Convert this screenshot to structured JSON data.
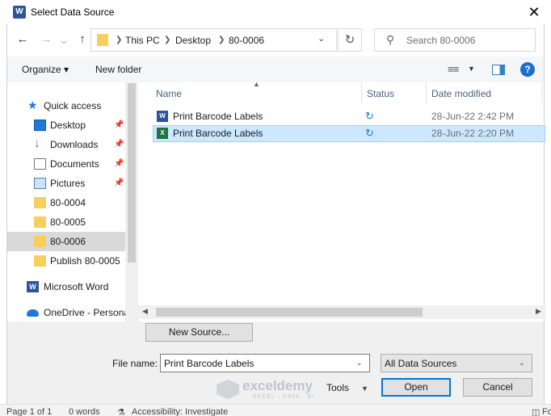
{
  "window": {
    "app_icon": "W",
    "title": "Select Data Source",
    "close": "✕"
  },
  "address": {
    "breadcrumbs": [
      "This PC",
      "Desktop",
      "80-0006"
    ],
    "search_placeholder": "Search 80-0006"
  },
  "toolbar": {
    "organize": "Organize ▾",
    "new_folder": "New folder",
    "help": "?"
  },
  "nav": {
    "items": [
      {
        "label": "Quick access",
        "icon": "star-icon"
      },
      {
        "label": "Desktop",
        "icon": "desktop-icon"
      },
      {
        "label": "Downloads",
        "icon": "download-icon"
      },
      {
        "label": "Documents",
        "icon": "documents-icon"
      },
      {
        "label": "Pictures",
        "icon": "pictures-icon"
      },
      {
        "label": "80-0004",
        "icon": "folder-icon"
      },
      {
        "label": "80-0005",
        "icon": "folder-icon"
      },
      {
        "label": "80-0006",
        "icon": "folder-icon"
      },
      {
        "label": "Publish 80-0005",
        "icon": "folder-icon"
      },
      {
        "label": "Microsoft Word",
        "icon": "word-icon"
      },
      {
        "label": "OneDrive - Persona",
        "icon": "onedrive-icon"
      }
    ]
  },
  "list": {
    "columns": [
      "Name",
      "Status",
      "Date modified"
    ],
    "files": [
      {
        "name": "Print Barcode Labels",
        "type": "word",
        "date": "28-Jun-22 2:42 PM"
      },
      {
        "name": "Print Barcode Labels",
        "type": "excel",
        "date": "28-Jun-22 2:20 PM"
      }
    ]
  },
  "bottom": {
    "new_source": "New Source...",
    "file_name_label": "File name:",
    "file_name_value": "Print Barcode Labels",
    "filter_value": "All Data Sources",
    "tools": "Tools",
    "open": "Open",
    "cancel": "Cancel"
  },
  "watermark": {
    "name": "exceldemy",
    "tag": "EXCEL · DATA · BI"
  },
  "statusbar": {
    "page": "Page 1 of 1",
    "words": "0 words",
    "accessibility": "Accessibility: Investigate",
    "focus": "Fo"
  }
}
